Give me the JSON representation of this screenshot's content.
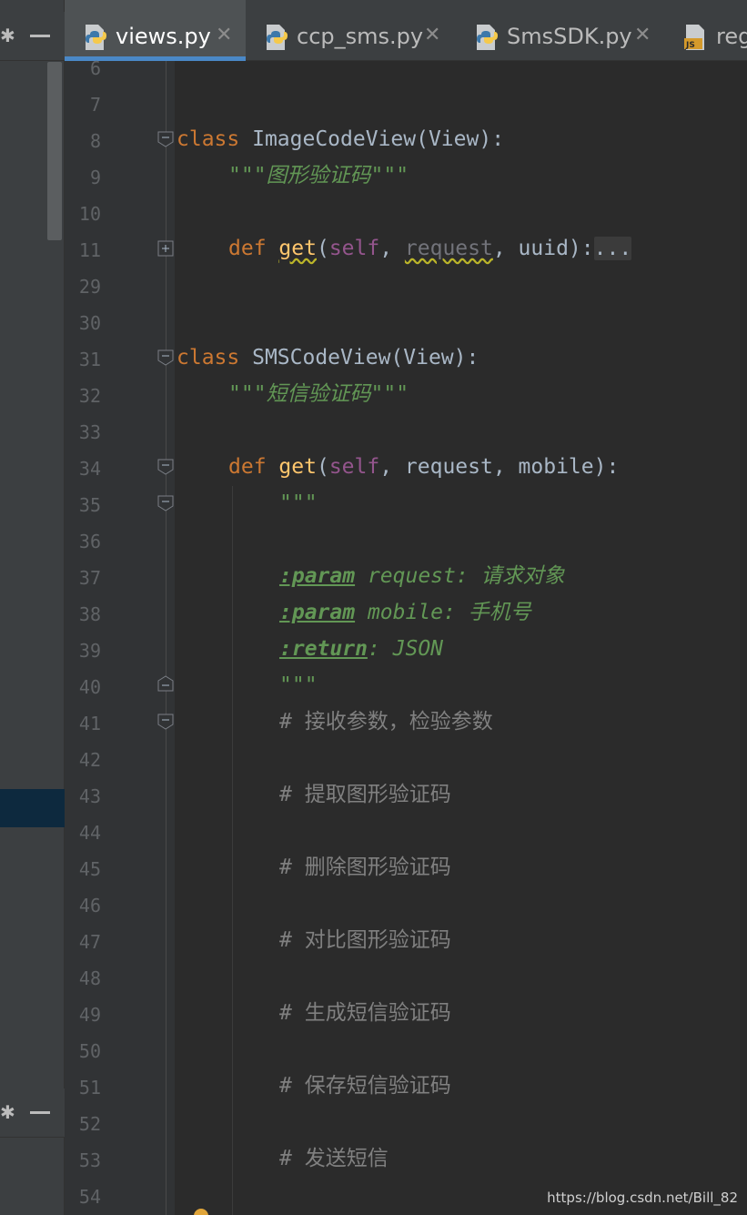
{
  "tabs": [
    {
      "label": "views.py",
      "active": true
    },
    {
      "label": "ccp_sms.py",
      "active": false
    },
    {
      "label": "SmsSDK.py",
      "active": false
    },
    {
      "label": "reg",
      "active": false
    }
  ],
  "close_glyph": "✕",
  "gear_glyph": "✱",
  "line_numbers": [
    "6",
    "7",
    "8",
    "9",
    "10",
    "11",
    "29",
    "30",
    "31",
    "32",
    "33",
    "34",
    "35",
    "36",
    "37",
    "38",
    "39",
    "40",
    "41",
    "42",
    "43",
    "44",
    "45",
    "46",
    "47",
    "48",
    "49",
    "50",
    "51",
    "52",
    "53",
    "54"
  ],
  "code": {
    "l8_kw": "class",
    "l8_rest": " ImageCodeView(View):",
    "l9_doc": "\"\"\"图形验证码\"\"\"",
    "l11_kw": "def",
    "l11_fn": "get",
    "l11_p1": "(",
    "l11_self": "self",
    "l11_p2": ", ",
    "l11_req": "request",
    "l11_p3": ", uuid):",
    "l11_fold": "...",
    "l31_kw": "class",
    "l31_rest": " SMSCodeView(View):",
    "l32_doc": "\"\"\"短信验证码\"\"\"",
    "l34_kw": "def",
    "l34_fn": "get",
    "l34_p1": "(",
    "l34_self": "self",
    "l34_p2": ", request, mobile):",
    "l35_doc": "\"\"\"",
    "l37_tag": ":param",
    "l37_rest": " request: 请求对象",
    "l38_tag": ":param",
    "l38_rest": " mobile: 手机号",
    "l39_tag": ":return",
    "l39_rest": ": JSON",
    "l40_doc": "\"\"\"",
    "l41": "# 接收参数，检验参数",
    "l43": "# 提取图形验证码",
    "l45": "# 删除图形验证码",
    "l47": "# 对比图形验证码",
    "l49": "# 生成短信验证码",
    "l51": "# 保存短信验证码",
    "l53": "# 发送短信"
  },
  "watermark": "https://blog.csdn.net/Bill_82",
  "colors": {
    "keyword": "#cc7832",
    "function": "#ffc66d",
    "self": "#94558d",
    "docstring": "#629755",
    "comment": "#808080",
    "text": "#a9b7c6",
    "tab_underline": "#4a88c7"
  }
}
